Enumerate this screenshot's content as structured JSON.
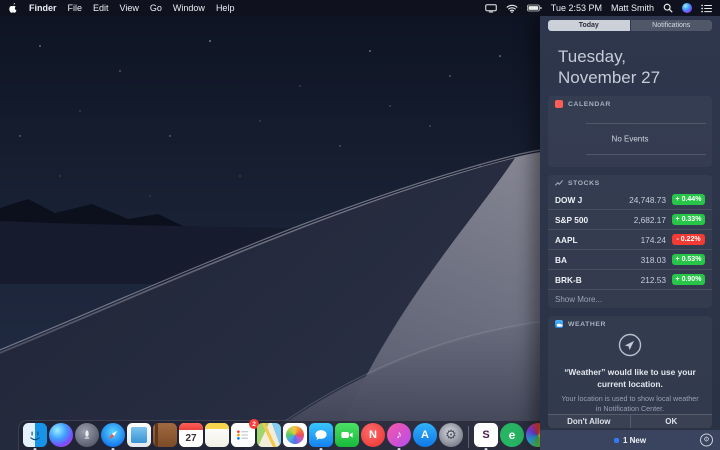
{
  "menu_bar": {
    "items": [
      "Finder",
      "File",
      "Edit",
      "View",
      "Go",
      "Window",
      "Help"
    ],
    "time": "Tue 2:53 PM",
    "user": "Matt Smith"
  },
  "notification_center": {
    "tabs": {
      "today": "Today",
      "notifications": "Notifications"
    },
    "date": {
      "line1": "Tuesday,",
      "line2": "November 27"
    },
    "calendar": {
      "title": "CALENDAR",
      "empty_label": "No Events"
    },
    "stocks": {
      "title": "STOCKS",
      "rows": [
        {
          "symbol": "DOW J",
          "price": "24,748.73",
          "change": "+ 0.44%",
          "direction": "up"
        },
        {
          "symbol": "S&P 500",
          "price": "2,682.17",
          "change": "+ 0.33%",
          "direction": "up"
        },
        {
          "symbol": "AAPL",
          "price": "174.24",
          "change": "- 0.22%",
          "direction": "down"
        },
        {
          "symbol": "BA",
          "price": "318.03",
          "change": "+ 0.53%",
          "direction": "up"
        },
        {
          "symbol": "BRK-B",
          "price": "212.53",
          "change": "+ 0.90%",
          "direction": "up"
        }
      ],
      "show_more_label": "Show More..."
    },
    "weather": {
      "title": "WEATHER",
      "permission_title": "“Weather” would like to use your current location.",
      "permission_body": "Your location is used to show local weather in Notification Center.",
      "deny_label": "Don't Allow",
      "allow_label": "OK"
    },
    "footer": {
      "new_label": "1 New"
    }
  },
  "dock": {
    "apps": [
      {
        "name": "finder",
        "running": true
      },
      {
        "name": "siri",
        "running": false
      },
      {
        "name": "launchpad",
        "running": false
      },
      {
        "name": "safari",
        "running": true
      },
      {
        "name": "mail",
        "running": false
      },
      {
        "name": "contacts",
        "running": false
      },
      {
        "name": "calendar",
        "running": false
      },
      {
        "name": "notes",
        "running": false
      },
      {
        "name": "reminders",
        "running": false
      },
      {
        "name": "maps",
        "running": false
      },
      {
        "name": "photos",
        "running": false
      },
      {
        "name": "messages",
        "running": true
      },
      {
        "name": "facetime",
        "running": false
      },
      {
        "name": "news",
        "running": false
      },
      {
        "name": "itunes",
        "running": true
      },
      {
        "name": "app-store",
        "running": false
      },
      {
        "name": "system-preferences",
        "running": false
      },
      {
        "name": "slack",
        "running": true
      },
      {
        "name": "evernote",
        "running": false
      },
      {
        "name": "color-wheel-app",
        "running": false
      }
    ],
    "calendar_day": "27",
    "reminders_badge": "2",
    "news_letter": "N",
    "itunes_glyph": "♪",
    "appstore_letter": "A",
    "sysprefs_glyph": "⚙",
    "slack_letter": "S",
    "evernote_letter": "e",
    "footer_gear_glyph": "⚙"
  },
  "colors": {
    "accent_green": "#27c648",
    "accent_red": "#f23b33",
    "panel": "#2c3448",
    "badge_blue": "#3478f6"
  }
}
